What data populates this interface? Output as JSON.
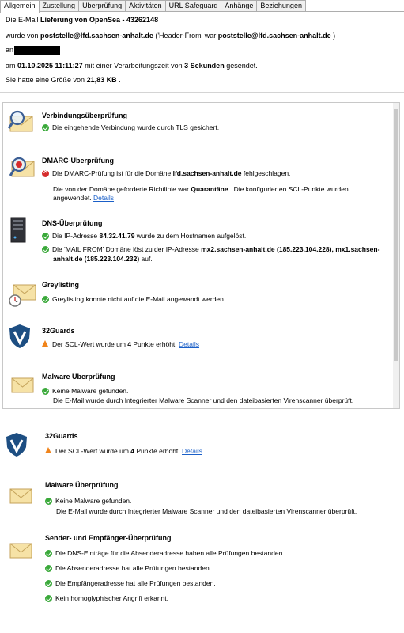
{
  "tabs": [
    "Allgemein",
    "Zustellung",
    "Überprüfung",
    "Aktivitäten",
    "URL Safeguard",
    "Anhänge",
    "Beziehungen"
  ],
  "header": {
    "line1_prefix": "Die E-Mail ",
    "line1_bold": "Lieferung von OpenSea - 43262148",
    "line2_prefix": "wurde von ",
    "line2_sender": "poststelle@lfd.sachsen-anhalt.de",
    "line2_mid": " ('Header-From' war ",
    "line2_from": "poststelle@lfd.sachsen-anhalt.de",
    "line2_suffix": " )",
    "line3_prefix": "an",
    "line4_prefix": "am ",
    "line4_date": "01.10.2025 11:11:27",
    "line4_mid": " mit einer Verarbeitungszeit von ",
    "line4_dur": "3 Sekunden",
    "line4_suffix": "  gesendet.",
    "line5_prefix": "Sie hatte eine Größe von ",
    "line5_size": "21,83 KB",
    "line5_suffix": " ."
  },
  "panel": {
    "verbindung": {
      "title": "Verbindungsüberprüfung",
      "l1": "Die eingehende Verbindung wurde durch TLS gesichert."
    },
    "dmarc": {
      "title": "DMARC-Überprüfung",
      "l1_prefix": "Die DMARC-Prüfung ist für die Domäne ",
      "l1_domain": "lfd.sachsen-anhalt.de",
      "l1_suffix": " fehlgeschlagen.",
      "l2_prefix": "Die von der Domäne geforderte Richtlinie war ",
      "l2_policy": "Quarantäne",
      "l2_suffix": " . Die konfigurierten SCL-Punkte wurden",
      "l3": "angewendet. ",
      "l3_link": "Details"
    },
    "dns": {
      "title": "DNS-Überprüfung",
      "l1_prefix": "Die IP-Adresse ",
      "l1_ip": "84.32.41.79",
      "l1_suffix": " wurde zu dem Hostnamen  aufgelöst.",
      "l2_prefix": "Die 'MAIL FROM' Domäne löst zu der IP-Adresse ",
      "l2_b1": "mx2.sachsen-anhalt.de (185.223.104.228), mx1.sachsen-",
      "l3_b": "anhalt.de (185.223.104.232)",
      "l3_suffix": " auf."
    },
    "grey": {
      "title": "Greylisting",
      "l1": "Greylisting konnte nicht auf die E-Mail angewandt werden."
    },
    "guards": {
      "title": "32Guards",
      "l1_prefix": "Der SCL-Wert wurde um ",
      "l1_pts": "4",
      "l1_suffix": " Punkte erhöht. ",
      "l1_link": "Details"
    },
    "malware": {
      "title": "Malware Überprüfung",
      "l1": "Keine Malware gefunden.",
      "l2": "Die E-Mail wurde durch Integrierter Malware Scanner und den dateibasierten Virenscanner überprüft."
    }
  },
  "lower": {
    "guards": {
      "title": "32Guards",
      "l1_prefix": "Der SCL-Wert wurde um ",
      "l1_pts": "4",
      "l1_suffix": " Punkte erhöht. ",
      "l1_link": "Details"
    },
    "malware": {
      "title": "Malware Überprüfung",
      "l1": "Keine Malware gefunden.",
      "l2": "Die E-Mail wurde durch Integrierter Malware Scanner und den dateibasierten Virenscanner überprüft."
    },
    "sender": {
      "title": "Sender- und Empfänger-Überprüfung",
      "items": [
        "Die DNS-Einträge für die Absenderadresse haben alle Prüfungen bestanden.",
        "Die Absenderadresse hat alle Prüfungen bestanden.",
        "Die Empfängeradresse hat alle Prüfungen bestanden.",
        "Kein homoglyphischer Angriff erkannt."
      ]
    }
  }
}
